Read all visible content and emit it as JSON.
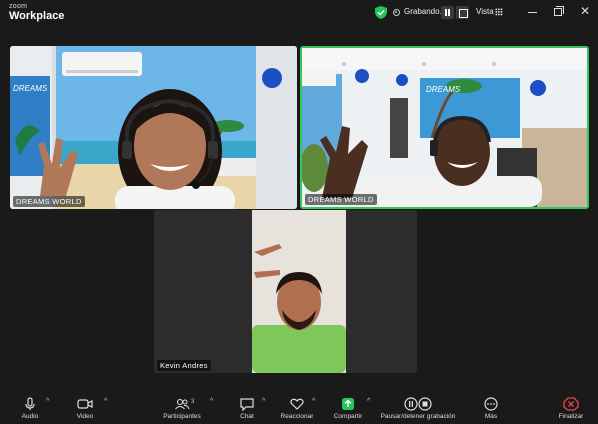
{
  "app": {
    "logo_small": "zoom",
    "logo_big": "Workplace"
  },
  "titlebar": {
    "recording_label": "Grabando...",
    "view_label": "Vista"
  },
  "tiles": [
    {
      "name": "DREAMS WORLD"
    },
    {
      "name": "DREAMS WORLD"
    },
    {
      "name": "Kevin Andres"
    }
  ],
  "toolbar": {
    "audio": "Audio",
    "video": "Video",
    "participants": "Participantes",
    "participants_count": "3",
    "chat": "Chat",
    "reactions": "Reaccionar",
    "share": "Compartir",
    "recording_control": "Pausar/detener grabación",
    "more": "Más",
    "end": "Finalizar"
  },
  "colors": {
    "active_speaker_border": "#34c759",
    "share_accent": "#22c55e",
    "end_accent": "#e5484d",
    "background": "#1a1a1a"
  }
}
